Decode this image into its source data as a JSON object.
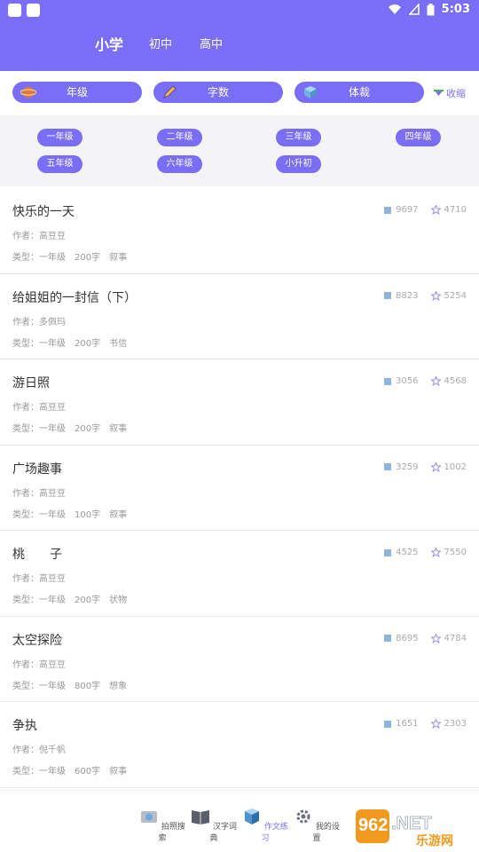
{
  "status": {
    "time": "5:03"
  },
  "tabs": [
    "小学",
    "初中",
    "高中"
  ],
  "filters": {
    "grade": "年级",
    "words": "字数",
    "genre": "体裁",
    "collapse": "收缩"
  },
  "grades": [
    "一年级",
    "二年级",
    "三年级",
    "四年级",
    "五年级",
    "六年级",
    "小升初"
  ],
  "essays": [
    {
      "title": "快乐的一天",
      "author": "作者：高豆豆",
      "type": "类型：一年级",
      "words": "200字",
      "genre": "叙事",
      "reads": "9697",
      "stars": "4710"
    },
    {
      "title": "给姐姐的一封信（下）",
      "author": "作者：多佩玛",
      "type": "类型：一年级",
      "words": "200字",
      "genre": "书信",
      "reads": "8823",
      "stars": "5254"
    },
    {
      "title": "游日照",
      "author": "作者：高豆豆",
      "type": "类型：一年级",
      "words": "200字",
      "genre": "叙事",
      "reads": "3056",
      "stars": "4568"
    },
    {
      "title": "广场趣事",
      "author": "作者：高豆豆",
      "type": "类型：一年级",
      "words": "100字",
      "genre": "叙事",
      "reads": "3259",
      "stars": "1002"
    },
    {
      "title": "桃　　子",
      "author": "作者：高豆豆",
      "type": "类型：一年级",
      "words": "200字",
      "genre": "状物",
      "reads": "4525",
      "stars": "7550"
    },
    {
      "title": "太空探险",
      "author": "作者：高豆豆",
      "type": "类型：一年级",
      "words": "800字",
      "genre": "想象",
      "reads": "8695",
      "stars": "4784"
    },
    {
      "title": "争执",
      "author": "作者：倪千帆",
      "type": "类型：一年级",
      "words": "600字",
      "genre": "叙事",
      "reads": "1651",
      "stars": "2303"
    }
  ],
  "bottom_nav": [
    "拍照搜索",
    "汉字词典",
    "作文练习",
    "我的设置"
  ],
  "watermark": {
    "brand": "962.NET",
    "site": "乐游网"
  },
  "colors": {
    "accent": "#7b6ef6"
  }
}
